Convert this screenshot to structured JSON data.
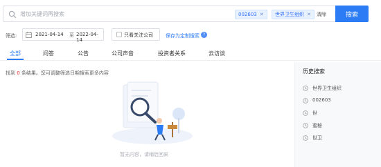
{
  "search": {
    "placeholder": "增加关键词再搜索",
    "tags": [
      "002603",
      "世界卫生组织"
    ],
    "clear_label": "清除",
    "submit_label": "搜索"
  },
  "filters": {
    "label": "筛选:",
    "date_start": "2021-04-14",
    "date_sep": "至",
    "date_end": "2022-04-14",
    "follow_label": "只看关注公司",
    "save_label": "保存为定制搜索"
  },
  "tabs": [
    "全部",
    "问答",
    "公告",
    "公司声音",
    "投资者关系",
    "云访谈"
  ],
  "result": {
    "prefix": "找到",
    "count": "0",
    "suffix": "条结果。您可调整筛选日期搜索更多内容"
  },
  "empty_text": "暂无内容，请稍后回来",
  "history": {
    "title": "历史搜索",
    "items": [
      "世界卫生组织",
      "002603",
      "世",
      "蜜秘",
      "世卫"
    ]
  },
  "colors": {
    "accent": "#2c7cf6",
    "count": "#e02020",
    "tag_bg": "#e8f1fe"
  }
}
